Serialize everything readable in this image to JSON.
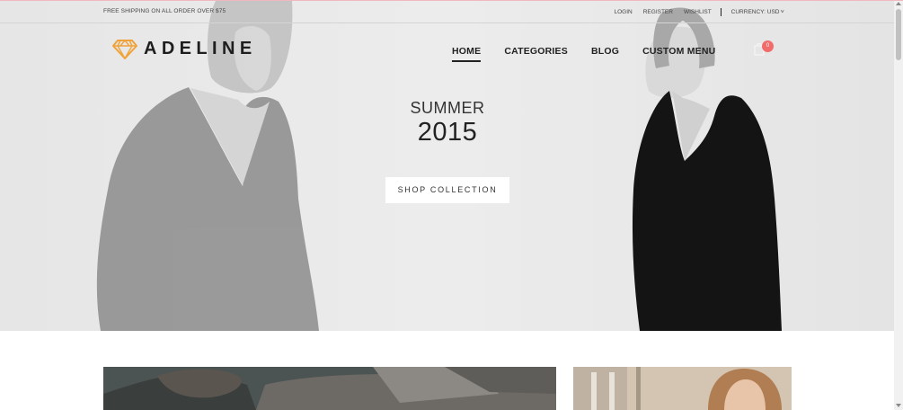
{
  "topbar": {
    "shipping_text": "FREE SHIPPING ON ALL ORDER OVER $75",
    "links": [
      "LOGIN",
      "REGISTER",
      "WISHLIST"
    ],
    "currency_label": "CURRENCY: USD"
  },
  "header": {
    "logo_text": "ADELINE",
    "nav": [
      "HOME",
      "CATEGORIES",
      "BLOG",
      "CUSTOM MENU"
    ],
    "cart_count": "0"
  },
  "hero": {
    "title_line1": "SUMMER",
    "title_line2": "2015",
    "cta_label": "SHOP COLLECTION"
  },
  "colors": {
    "hero_bg": "#e8e8e8",
    "badge": "#f16b6b",
    "logo_icon": "#f0a23a",
    "accent_line": "#f2b8c0"
  },
  "icons": {
    "logo": "diamond-icon",
    "cart": "shopping-bag-icon",
    "currency_chevron": "chevron-down-icon"
  }
}
